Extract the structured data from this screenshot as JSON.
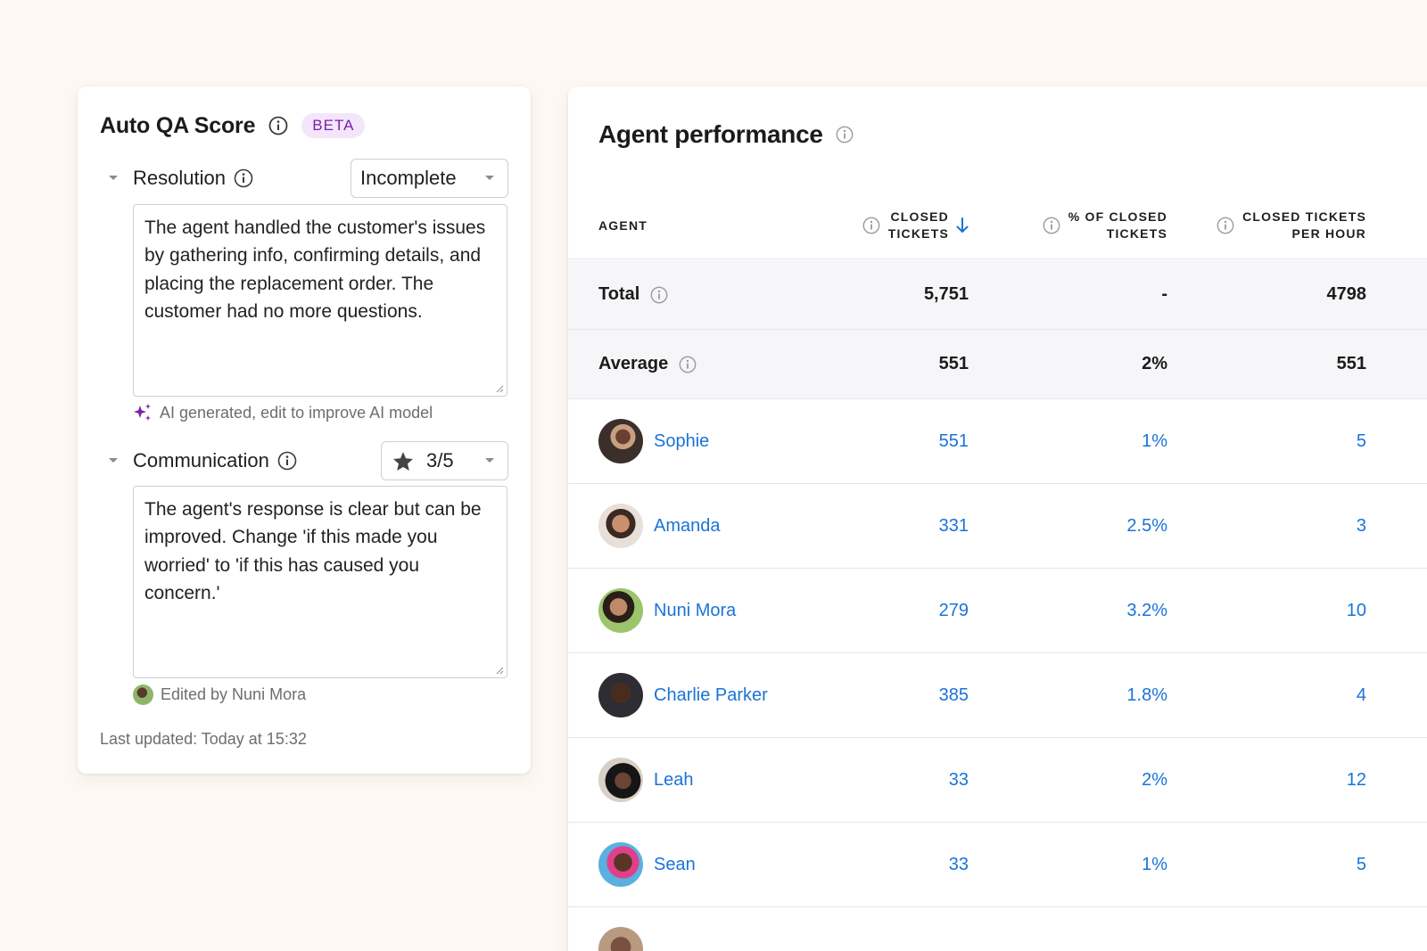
{
  "qa": {
    "title": "Auto QA Score",
    "badge": "BETA",
    "criteria": [
      {
        "label": "Resolution",
        "select_value": "Incomplete",
        "text": "The agent handled the customer's issues by gathering info, confirming details, and placing the replacement order. The customer had no more questions.",
        "hint": "AI generated, edit to improve AI model"
      },
      {
        "label": "Communication",
        "select_value": "3/5",
        "text": "The agent's response is clear but can be improved. Change 'if this made you worried' to 'if this has caused you concern.'",
        "hint": "Edited by Nuni Mora"
      }
    ],
    "last_updated": "Last updated: Today at 15:32"
  },
  "perf": {
    "title": "Agent performance",
    "columns": {
      "agent": "AGENT",
      "closed_1": "CLOSED",
      "closed_2": "TICKETS",
      "pct_1": "% OF CLOSED",
      "pct_2": "TICKETS",
      "hour_1": "CLOSED TICKETS",
      "hour_2": "PER HOUR"
    },
    "total": {
      "label": "Total",
      "closed": "5,751",
      "pct": "-",
      "per_hour": "4798"
    },
    "average": {
      "label": "Average",
      "closed": "551",
      "pct": "2%",
      "per_hour": "551"
    },
    "agents": [
      {
        "name": "Sophie",
        "closed": "551",
        "pct": "1%",
        "per_hour": "5"
      },
      {
        "name": "Amanda",
        "closed": "331",
        "pct": "2.5%",
        "per_hour": "3"
      },
      {
        "name": "Nuni Mora",
        "closed": "279",
        "pct": "3.2%",
        "per_hour": "10"
      },
      {
        "name": "Charlie Parker",
        "closed": "385",
        "pct": "1.8%",
        "per_hour": "4"
      },
      {
        "name": "Leah",
        "closed": "33",
        "pct": "2%",
        "per_hour": "12"
      },
      {
        "name": "Sean",
        "closed": "33",
        "pct": "1%",
        "per_hour": "5"
      }
    ]
  },
  "colors": {
    "accent_link": "#1a73d9",
    "badge_bg": "#f3e6fb",
    "badge_text": "#7a20a8",
    "ai_sparkle": "#7a20a8",
    "page_bg": "#fdf8f3"
  }
}
